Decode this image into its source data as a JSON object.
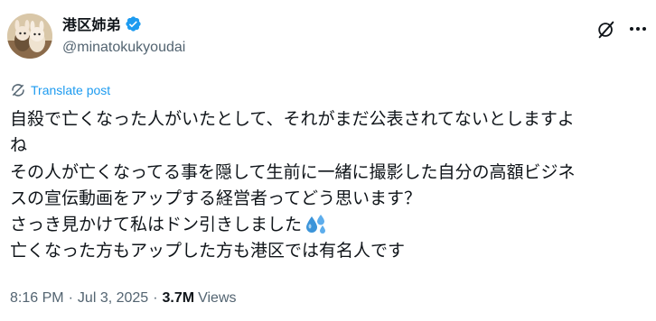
{
  "author": {
    "display_name": "港区姉弟",
    "handle": "@minatokukyoudai",
    "verified_color": "#1d9bf0"
  },
  "actions": {
    "grok_icon": "grok-icon",
    "more_icon": "more-icon"
  },
  "translate": {
    "label": "Translate post"
  },
  "post": {
    "lines": [
      "自殺で亡くなった人がいたとして、それがまだ公表されてないとしますよ",
      "ね",
      "その人が亡くなってる事を隠して生前に一緒に撮影した自分の高額ビジネ",
      "スの宣伝動画をアップする経営者ってどう思います？",
      "さっき見かけて私はドン引きしました",
      "亡くなった方もアップした方も港区では有名人です"
    ],
    "emoji": "sweat-droplets-emoji"
  },
  "meta": {
    "time": "8:16 PM",
    "date": "Jul 3, 2025",
    "separator": "·",
    "views_count": "3.7M",
    "views_label": "Views"
  }
}
